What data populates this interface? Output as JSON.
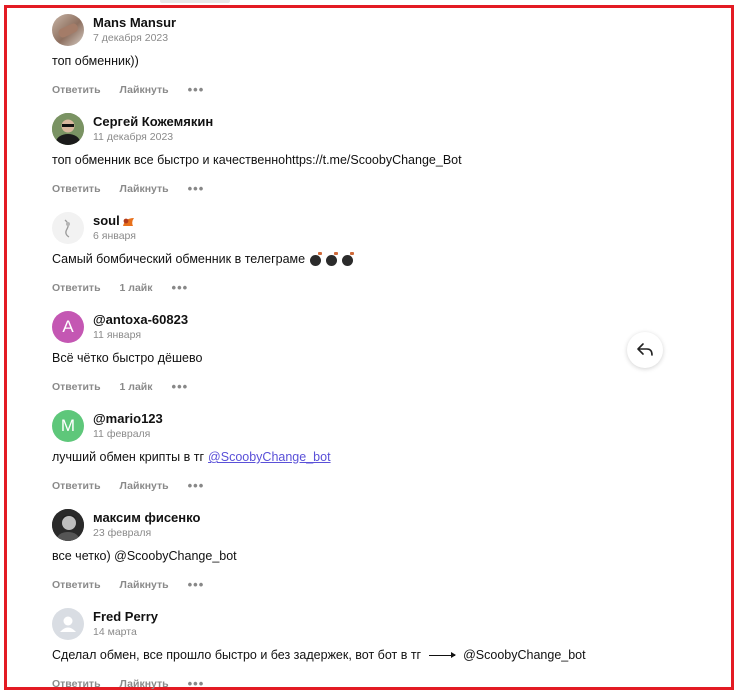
{
  "actions": {
    "reply_label": "Ответить",
    "like_label": "Лайкнуть",
    "more_label": "•••"
  },
  "comments": [
    {
      "author": "Mans Mansur",
      "date": "7 декабря 2023",
      "text": "топ обменник))",
      "like": "Лайкнуть"
    },
    {
      "author": "Сергей Кожемякин",
      "date": "11 декабря 2023",
      "text": "топ обменник все быстро и качественноhttps://t.me/ScoobyChange_Bot",
      "like": "Лайкнуть"
    },
    {
      "author": "soul",
      "date": "6 января",
      "text": "Самый бомбический обменник в телеграме",
      "like": "1 лайк"
    },
    {
      "author": "@antoxa-60823",
      "avatar_letter": "A",
      "avatar_color": "#c457b3",
      "date": "11 января",
      "text": "Всё чётко быстро дёшево",
      "like": "1 лайк"
    },
    {
      "author": "@mario123",
      "avatar_letter": "M",
      "avatar_color": "#5ec77a",
      "date": "11 февраля",
      "text": "лучший обмен крипты в тг",
      "link": "@ScoobyChange_bot",
      "like": "Лайкнуть"
    },
    {
      "author": "максим фисенко",
      "date": "23 февраля",
      "text": "все четко) @ScoobyChange_bot",
      "like": "Лайкнуть"
    },
    {
      "author": "Fred Perry",
      "date": "14 марта",
      "text": "Сделал обмен, все прошло быстро и без задержек, вот бот в тг",
      "text_after_arrow": "@ScoobyChange_bot",
      "like": "Лайкнуть"
    }
  ],
  "colors": {
    "frame": "#e31b23",
    "link": "#5a50d8",
    "muted": "#8a8a8a"
  }
}
